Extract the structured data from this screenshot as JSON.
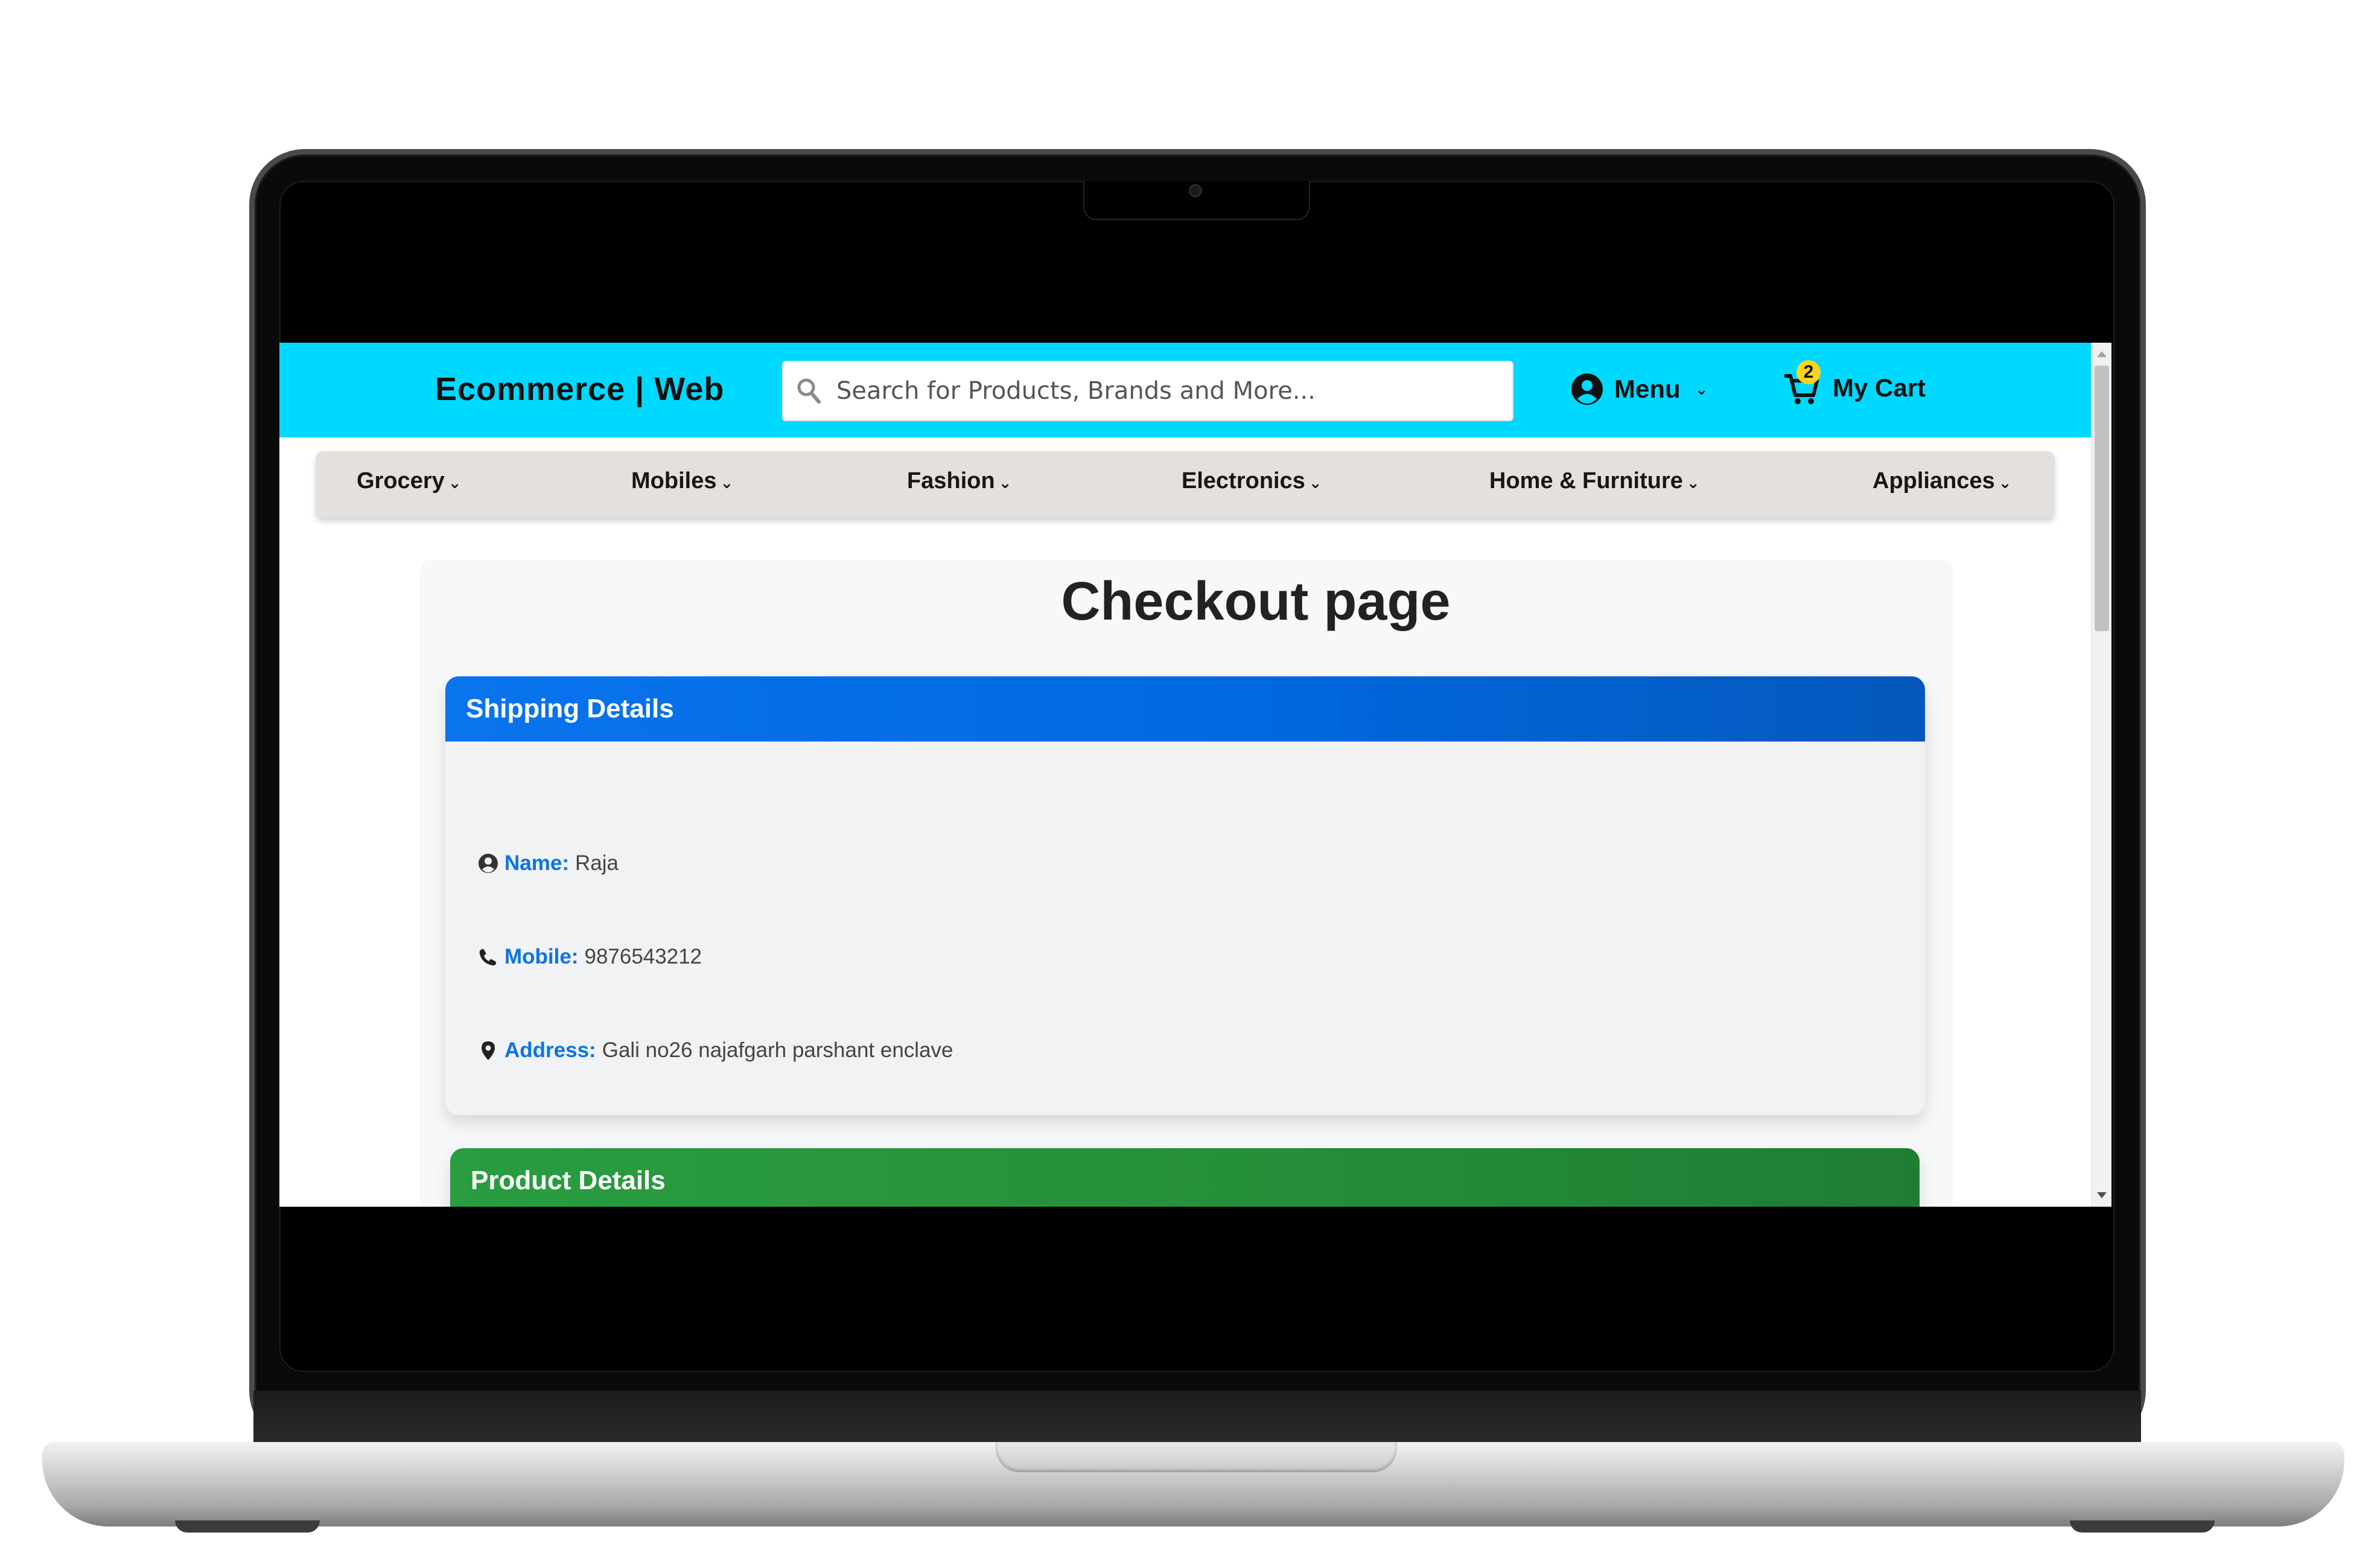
{
  "header": {
    "brand": "Ecommerce | Web",
    "search_placeholder": "Search for Products, Brands and More...",
    "menu_label": "Menu",
    "cart_label": "My Cart",
    "cart_count": "2"
  },
  "categories": [
    {
      "label": "Grocery"
    },
    {
      "label": "Mobiles"
    },
    {
      "label": "Fashion"
    },
    {
      "label": "Electronics"
    },
    {
      "label": "Home & Furniture"
    },
    {
      "label": "Appliances"
    }
  ],
  "checkout": {
    "title": "Checkout page",
    "shipping": {
      "header": "Shipping Details",
      "name_label": "Name:",
      "name_value": "Raja",
      "mobile_label": "Mobile:",
      "mobile_value": "9876543212",
      "address_label": "Address:",
      "address_value": "Gali no26 najafgarh parshant enclave"
    },
    "product": {
      "header": "Product Details"
    }
  },
  "colors": {
    "topbar": "#00d9ff",
    "category_bar": "#e4e0de",
    "shipping_header": "#0a74ee",
    "product_header": "#2a9d40",
    "label_blue": "#0b74e5",
    "badge": "#ffd21f"
  },
  "icons": {
    "search": "search-icon",
    "menu": "user-circle-icon",
    "cart": "cart-icon",
    "name": "user-circle-icon",
    "mobile": "phone-icon",
    "address": "map-marker-icon",
    "dropdown": "chevron-down-icon"
  }
}
